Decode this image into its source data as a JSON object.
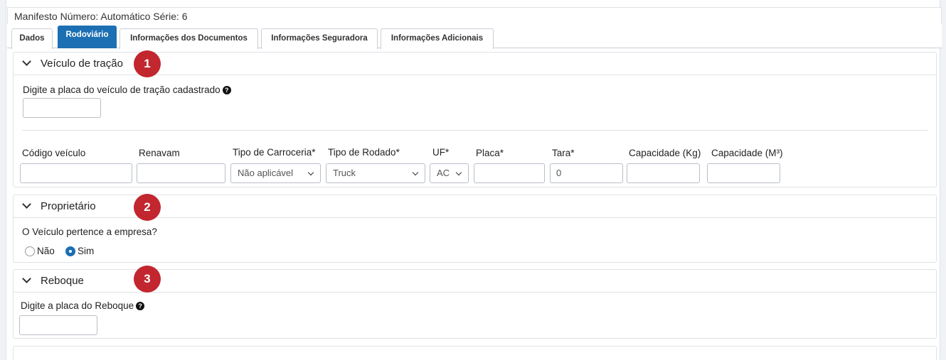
{
  "header": {
    "title": "Manifesto Número: Automático Série: 6"
  },
  "tabs": [
    {
      "label": "Dados",
      "active": false
    },
    {
      "label": "Rodoviário",
      "active": true
    },
    {
      "label": "Informações dos Documentos",
      "active": false
    },
    {
      "label": "Informações Seguradora",
      "active": false
    },
    {
      "label": "Informações Adicionais",
      "active": false
    }
  ],
  "veiculo": {
    "title": "Veículo de tração",
    "badge": "1",
    "placa_label": "Digite a placa do veículo de tração cadastrado",
    "placa_value": "",
    "fields": {
      "codigo": {
        "label": "Código veículo",
        "value": ""
      },
      "renavam": {
        "label": "Renavam",
        "value": ""
      },
      "carroceria": {
        "label": "Tipo de Carroceria*",
        "value": "Não aplicável"
      },
      "rodado": {
        "label": "Tipo de Rodado*",
        "value": "Truck"
      },
      "uf": {
        "label": "UF*",
        "value": "AC"
      },
      "placa": {
        "label": "Placa*",
        "value": ""
      },
      "tara": {
        "label": "Tara*",
        "value": "0"
      },
      "cap_kg": {
        "label": "Capacidade (Kg)",
        "value": ""
      },
      "cap_m3": {
        "label": "Capacidade (M³)",
        "value": ""
      }
    }
  },
  "proprietario": {
    "title": "Proprietário",
    "badge": "2",
    "question": "O Veículo pertence a empresa?",
    "options": [
      {
        "label": "Não",
        "checked": false
      },
      {
        "label": "Sim",
        "checked": true
      }
    ]
  },
  "reboque": {
    "title": "Reboque",
    "badge": "3",
    "placa_label": "Digite a placa do Reboque",
    "placa_value": ""
  },
  "icons": {
    "help": "question-circle-icon",
    "chevron": "chevron-down-icon"
  },
  "colors": {
    "accent": "#1c6fb3",
    "badge": "#c2262e"
  }
}
